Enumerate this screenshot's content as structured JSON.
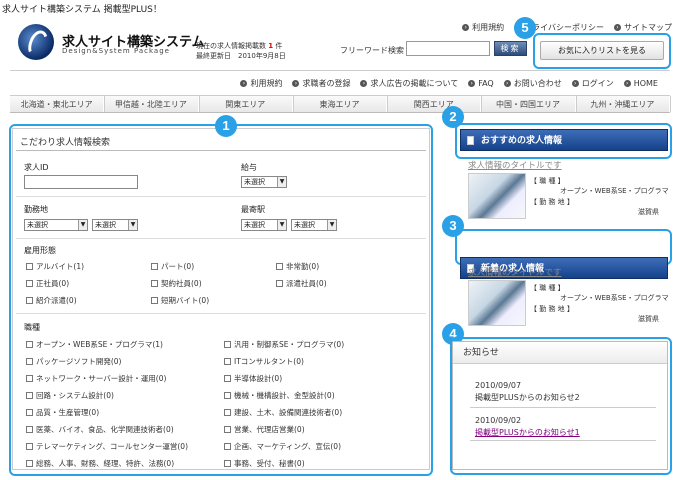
{
  "top": {
    "tagline": "求人サイト構築システム 掲載型PLUS！"
  },
  "header": {
    "site_title": "求人サイト構築システム",
    "site_subtitle": "Design&System Package",
    "count_line1_pre": "現在の求人情報掲載数",
    "count_value": "1",
    "count_unit": "件",
    "count_line2": "最終更新日　2010年9月8日",
    "util_links": [
      "利用規約",
      "プライバシーポリシー",
      "サイトマップ"
    ],
    "keyword_label": "フリーワード検索",
    "keyword_value": "",
    "search_btn": "検索",
    "fav_btn": "お気に入りリストを見る"
  },
  "sub_nav": [
    "利用規約",
    "求職者の登録",
    "求人広告の掲載について",
    "FAQ",
    "お問い合わせ",
    "ログイン",
    "HOME"
  ],
  "area_nav": [
    "北海道・東北エリア",
    "甲信越・北陸エリア",
    "関東エリア",
    "東海エリア",
    "関西エリア",
    "中国・四国エリア",
    "九州・沖縄エリア"
  ],
  "badges": [
    "1",
    "2",
    "3",
    "4",
    "5"
  ],
  "search": {
    "title": "こだわり求人情報検索",
    "job_id_label": "求人ID",
    "salary_label": "給与",
    "salary_value": "未選択",
    "location_label": "勤務地",
    "location_value1": "未選択",
    "location_value2": "未選択",
    "station_label": "最寄駅",
    "station_value1": "未選択",
    "station_value2": "未選択",
    "employment_label": "雇用形態",
    "employment": [
      "アルバイト(1)",
      "パート(0)",
      "非常勤(0)",
      "正社員(0)",
      "契約社員(0)",
      "派遣社員(0)",
      "紹介派遣(0)",
      "短期バイト(0)"
    ],
    "occupation_label": "職種",
    "occupations": [
      "オープン・WEB系SE・プログラマ(1)",
      "汎用・制御系SE・プログラマ(0)",
      "パッケージソフト開発(0)",
      "ITコンサルタント(0)",
      "ネットワーク・サーバー設計・運用(0)",
      "半導体設計(0)",
      "回路・システム設計(0)",
      "機械・機構設計、金型設計(0)",
      "品質・生産管理(0)",
      "建設、土木、設備関連技術者(0)",
      "医薬、バイオ、食品、化学関連技術者(0)",
      "営業、代理店営業(0)",
      "テレマーケティング、コールセンター運営(0)",
      "企画、マーケティング、宣伝(0)",
      "総務、人事、財務、経理、特許、法務(0)",
      "事務、受付、秘書(0)"
    ]
  },
  "recommended": {
    "heading": "おすすめの求人情報",
    "job_title": "求人情報のタイトルです",
    "type_label": "【 職 種 】",
    "type_value": "オープン・WEB系SE・プログラマ",
    "place_label": "【 勤 務 地 】",
    "place_value": "滋賀県"
  },
  "new_jobs": {
    "heading": "新着の求人情報",
    "job_title": "求人情報のタイトルです",
    "type_label": "【 職 種 】",
    "type_value": "オープン・WEB系SE・プログラマ",
    "place_label": "【 勤 務 地 】",
    "place_value": "滋賀県"
  },
  "news": {
    "heading": "お知らせ",
    "items": [
      {
        "date": "2010/09/07",
        "text": "掲載型PLUSからのお知らせ2"
      },
      {
        "date": "2010/09/02",
        "text": "掲載型PLUSからのお知らせ1"
      }
    ]
  }
}
